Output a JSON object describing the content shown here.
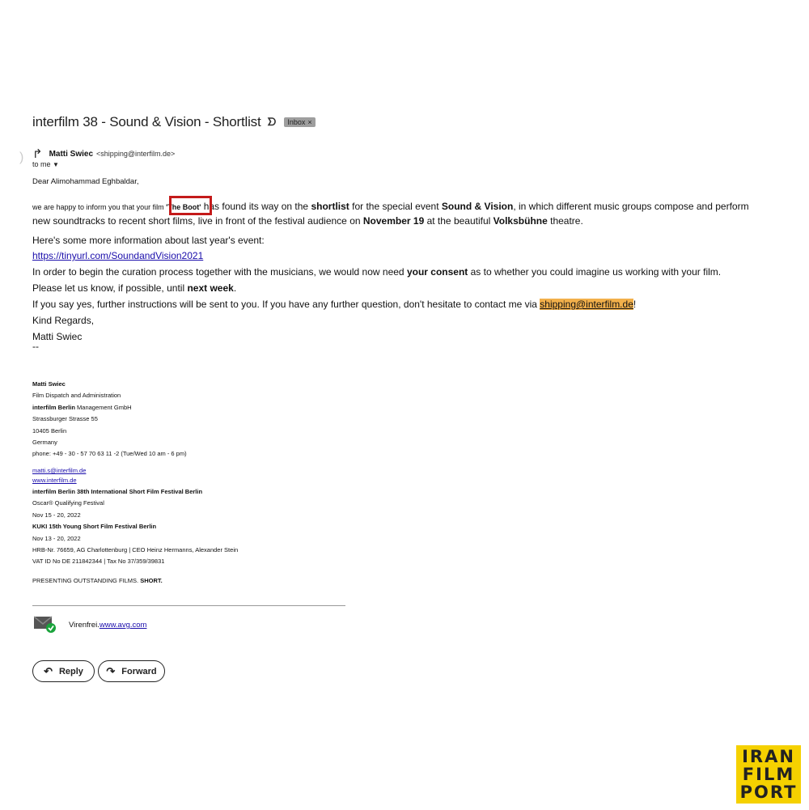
{
  "email": {
    "subject": "interfilm 38 - Sound & Vision - Shortlist",
    "important_glyph": "ᗤ",
    "label": "Inbox",
    "label_close": "×",
    "sender_name": "Matti Swiec",
    "sender_email": "<shipping@interfilm.de>",
    "to": "to me",
    "greeting": "Dear Alimohammad Eghbaldar,",
    "para1": {
      "a": "we are happy to inform you that your film ",
      "film": "'The Boot'",
      "b": " has found its way on the ",
      "shortlist": "shortlist",
      "c": " for the special event ",
      "event": "Sound & Vision",
      "d": ", in which different music groups compose and perform new soundtracks to recent short films, live in front of the festival audience on ",
      "date": "November 19",
      "e": " at the beautiful ",
      "venue": "Volksbühne",
      "f": " theatre."
    },
    "info_line": "Here's some more information about last year's event:",
    "info_link": "https://tinyurl.com/SoundandVision2021",
    "consent": {
      "a": "In order to begin the curation process together with the musicians, we would now need ",
      "bold": "your consent",
      "b": " as to whether you could imagine us working with your film."
    },
    "deadline": {
      "a": "Please let us know, if possible, until ",
      "bold": "next week",
      "b": "."
    },
    "contact": {
      "a": "If you say yes, further instructions will be sent to you. If you have any further question, don't hesitate to contact me via ",
      "link": "shipping@interfilm.de",
      "b": "!"
    },
    "kind_regards": "Kind Regards,",
    "signoff_name": "Matti Swiec",
    "dashes": "--"
  },
  "signature": {
    "name": "Matti Swiec",
    "role": "Film Dispatch and Administration",
    "company_bold": "interfilm Berlin",
    "company_rest": " Management GmbH",
    "street": "Strassburger Strasse 55",
    "city": "10405 Berlin",
    "country": "Germany",
    "phone": "phone: +49 - 30 - 57 70 63 11 -2 (Tue/Wed 10 am - 6 pm)",
    "email": "matti.s@interfilm.de",
    "website": "www.interfilm.de",
    "festival": "interfilm Berlin 38th International Short Film Festival Berlin",
    "oscar": "Oscar® Qualifying Festival",
    "festival_dates": "Nov 15 - 20, 2022",
    "kuki": "KUKI 15th Young Short Film Festival Berlin",
    "kuki_dates": "Nov 13 - 20, 2022",
    "hrb": "HRB-Nr. 76659, AG Charlottenburg | CEO Heinz Hermanns, Alexander Stein",
    "vat": "VAT ID No DE 211842344 | Tax No 37/359/39831",
    "presenting_a": "PRESENTING OUTSTANDING FILMS. ",
    "presenting_b": "SHORT."
  },
  "avg": {
    "text": "Virenfrei.",
    "link": "www.avg.com",
    "icon": "envelope-check-icon"
  },
  "actions": {
    "reply": "Reply",
    "forward": "Forward"
  },
  "logo": {
    "line1": "IRAN",
    "line2": "FILM",
    "line3": "PORT"
  },
  "colors": {
    "highlight_box": "#c41a1a",
    "link_highlight": "#f2b04b",
    "link": "#1a0dab",
    "logo_bg": "#f5d100"
  }
}
